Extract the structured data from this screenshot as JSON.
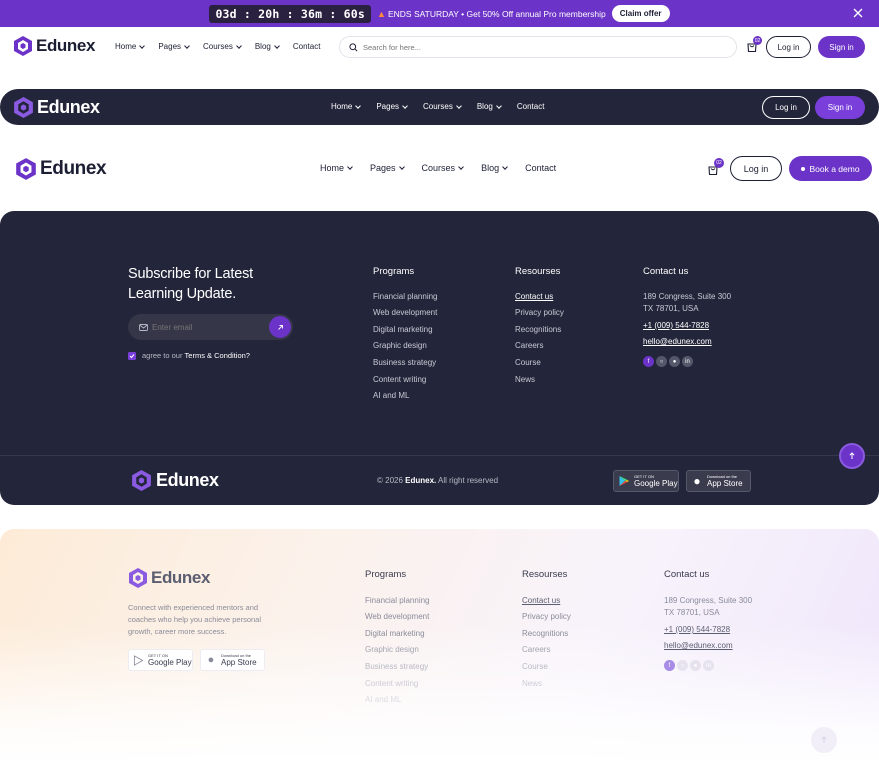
{
  "promo": {
    "timer": "03d : 20h : 36m : 60s",
    "fire_icon": "fire-icon",
    "message": "ENDS SATURDAY • Get 50% Off annual Pro membership",
    "cta": "Claim offer",
    "close_icon": "close-icon"
  },
  "brand": {
    "name": "Edunex",
    "logo_icon": "hexagon-stack-icon",
    "accent": "#6b33c7",
    "dark": "#23253a"
  },
  "header1": {
    "nav": [
      "Home",
      "Pages",
      "Courses",
      "Blog",
      "Contact"
    ],
    "search_placeholder": "Search for here...",
    "cart_count": "02",
    "login": "Log in",
    "signin": "Sign in"
  },
  "header2": {
    "nav": [
      "Home",
      "Pages",
      "Courses",
      "Blog",
      "Contact"
    ],
    "login": "Log in",
    "signin": "Sign in"
  },
  "header3": {
    "nav": [
      "Home",
      "Pages",
      "Courses",
      "Blog",
      "Contact"
    ],
    "cart_count": "02",
    "login": "Log in",
    "demo": "Book a demo"
  },
  "footer_dark": {
    "subscribe_title_1": "Subscribe for Latest",
    "subscribe_title_2": "Learning Update.",
    "email_placeholder": "Enter email",
    "agree_prefix": "agree to our ",
    "agree_link": "Terms & Condition?",
    "programs_title": "Programs",
    "programs": [
      "Financial planning",
      "Web development",
      "Digital marketing",
      "Graphic design",
      "Business strategy",
      "Content writing",
      "AI and ML"
    ],
    "resources_title": "Resourses",
    "resources": [
      "Contact us",
      "Privacy policy",
      "Recognitions",
      "Careers",
      "Course",
      "News"
    ],
    "contact_title": "Contact us",
    "address_1": "189 Congress, Suite 300",
    "address_2": "TX 78701, USA",
    "phone": "+1 (009) 544-7828",
    "email": "hello@edunex.com",
    "copyright_prefix": "© 2026 ",
    "copyright_brand": "Edunex.",
    "copyright_suffix": " All right reserved",
    "google_small": "GET IT ON",
    "google_big": "Google Play",
    "apple_small": "Download on the",
    "apple_big": "App Store"
  },
  "footer_light": {
    "description_1": "Connect with experienced mentors and",
    "description_2": "coaches who help you achieve personal",
    "description_3": "growth, career more success.",
    "programs_title": "Programs",
    "programs": [
      "Financial planning",
      "Web development",
      "Digital marketing",
      "Graphic design",
      "Business strategy",
      "Content writing",
      "AI and ML"
    ],
    "resources_title": "Resourses",
    "resources": [
      "Contact us",
      "Privacy policy",
      "Recognitions",
      "Careers",
      "Course",
      "News"
    ],
    "contact_title": "Contact us",
    "address_1": "189 Congress, Suite 300",
    "address_2": "TX 78701, USA",
    "phone": "+1 (009) 544-7828",
    "email": "hello@edunex.com",
    "google_small": "GET IT ON",
    "google_big": "Google Play",
    "apple_small": "Download on the",
    "apple_big": "App Store"
  }
}
